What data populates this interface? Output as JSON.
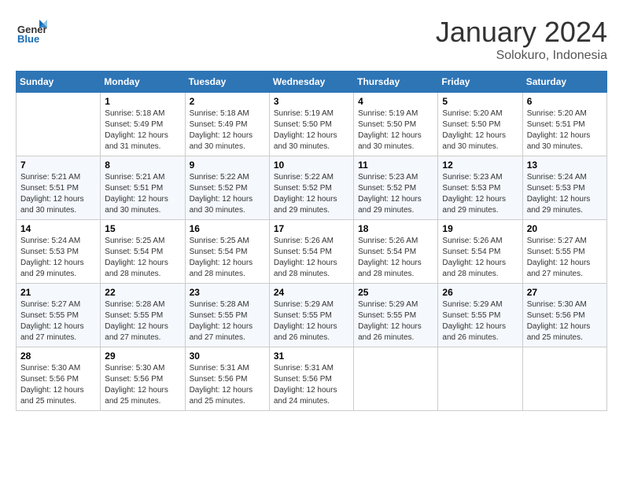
{
  "logo": {
    "general": "General",
    "blue": "Blue"
  },
  "header": {
    "month": "January 2024",
    "location": "Solokuro, Indonesia"
  },
  "weekdays": [
    "Sunday",
    "Monday",
    "Tuesday",
    "Wednesday",
    "Thursday",
    "Friday",
    "Saturday"
  ],
  "weeks": [
    [
      {
        "day": "",
        "info": ""
      },
      {
        "day": "1",
        "info": "Sunrise: 5:18 AM\nSunset: 5:49 PM\nDaylight: 12 hours\nand 31 minutes."
      },
      {
        "day": "2",
        "info": "Sunrise: 5:18 AM\nSunset: 5:49 PM\nDaylight: 12 hours\nand 30 minutes."
      },
      {
        "day": "3",
        "info": "Sunrise: 5:19 AM\nSunset: 5:50 PM\nDaylight: 12 hours\nand 30 minutes."
      },
      {
        "day": "4",
        "info": "Sunrise: 5:19 AM\nSunset: 5:50 PM\nDaylight: 12 hours\nand 30 minutes."
      },
      {
        "day": "5",
        "info": "Sunrise: 5:20 AM\nSunset: 5:50 PM\nDaylight: 12 hours\nand 30 minutes."
      },
      {
        "day": "6",
        "info": "Sunrise: 5:20 AM\nSunset: 5:51 PM\nDaylight: 12 hours\nand 30 minutes."
      }
    ],
    [
      {
        "day": "7",
        "info": "Sunrise: 5:21 AM\nSunset: 5:51 PM\nDaylight: 12 hours\nand 30 minutes."
      },
      {
        "day": "8",
        "info": "Sunrise: 5:21 AM\nSunset: 5:51 PM\nDaylight: 12 hours\nand 30 minutes."
      },
      {
        "day": "9",
        "info": "Sunrise: 5:22 AM\nSunset: 5:52 PM\nDaylight: 12 hours\nand 30 minutes."
      },
      {
        "day": "10",
        "info": "Sunrise: 5:22 AM\nSunset: 5:52 PM\nDaylight: 12 hours\nand 29 minutes."
      },
      {
        "day": "11",
        "info": "Sunrise: 5:23 AM\nSunset: 5:52 PM\nDaylight: 12 hours\nand 29 minutes."
      },
      {
        "day": "12",
        "info": "Sunrise: 5:23 AM\nSunset: 5:53 PM\nDaylight: 12 hours\nand 29 minutes."
      },
      {
        "day": "13",
        "info": "Sunrise: 5:24 AM\nSunset: 5:53 PM\nDaylight: 12 hours\nand 29 minutes."
      }
    ],
    [
      {
        "day": "14",
        "info": "Sunrise: 5:24 AM\nSunset: 5:53 PM\nDaylight: 12 hours\nand 29 minutes."
      },
      {
        "day": "15",
        "info": "Sunrise: 5:25 AM\nSunset: 5:54 PM\nDaylight: 12 hours\nand 28 minutes."
      },
      {
        "day": "16",
        "info": "Sunrise: 5:25 AM\nSunset: 5:54 PM\nDaylight: 12 hours\nand 28 minutes."
      },
      {
        "day": "17",
        "info": "Sunrise: 5:26 AM\nSunset: 5:54 PM\nDaylight: 12 hours\nand 28 minutes."
      },
      {
        "day": "18",
        "info": "Sunrise: 5:26 AM\nSunset: 5:54 PM\nDaylight: 12 hours\nand 28 minutes."
      },
      {
        "day": "19",
        "info": "Sunrise: 5:26 AM\nSunset: 5:54 PM\nDaylight: 12 hours\nand 28 minutes."
      },
      {
        "day": "20",
        "info": "Sunrise: 5:27 AM\nSunset: 5:55 PM\nDaylight: 12 hours\nand 27 minutes."
      }
    ],
    [
      {
        "day": "21",
        "info": "Sunrise: 5:27 AM\nSunset: 5:55 PM\nDaylight: 12 hours\nand 27 minutes."
      },
      {
        "day": "22",
        "info": "Sunrise: 5:28 AM\nSunset: 5:55 PM\nDaylight: 12 hours\nand 27 minutes."
      },
      {
        "day": "23",
        "info": "Sunrise: 5:28 AM\nSunset: 5:55 PM\nDaylight: 12 hours\nand 27 minutes."
      },
      {
        "day": "24",
        "info": "Sunrise: 5:29 AM\nSunset: 5:55 PM\nDaylight: 12 hours\nand 26 minutes."
      },
      {
        "day": "25",
        "info": "Sunrise: 5:29 AM\nSunset: 5:55 PM\nDaylight: 12 hours\nand 26 minutes."
      },
      {
        "day": "26",
        "info": "Sunrise: 5:29 AM\nSunset: 5:55 PM\nDaylight: 12 hours\nand 26 minutes."
      },
      {
        "day": "27",
        "info": "Sunrise: 5:30 AM\nSunset: 5:56 PM\nDaylight: 12 hours\nand 25 minutes."
      }
    ],
    [
      {
        "day": "28",
        "info": "Sunrise: 5:30 AM\nSunset: 5:56 PM\nDaylight: 12 hours\nand 25 minutes."
      },
      {
        "day": "29",
        "info": "Sunrise: 5:30 AM\nSunset: 5:56 PM\nDaylight: 12 hours\nand 25 minutes."
      },
      {
        "day": "30",
        "info": "Sunrise: 5:31 AM\nSunset: 5:56 PM\nDaylight: 12 hours\nand 25 minutes."
      },
      {
        "day": "31",
        "info": "Sunrise: 5:31 AM\nSunset: 5:56 PM\nDaylight: 12 hours\nand 24 minutes."
      },
      {
        "day": "",
        "info": ""
      },
      {
        "day": "",
        "info": ""
      },
      {
        "day": "",
        "info": ""
      }
    ]
  ]
}
